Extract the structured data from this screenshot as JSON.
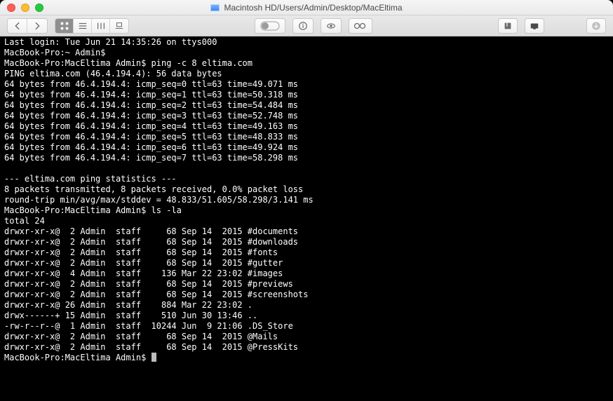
{
  "window": {
    "title": "Macintosh HD/Users/Admin/Desktop/MacEltima"
  },
  "terminal": {
    "last_login": "Last login: Tue Jun 21 14:35:26 on ttys000",
    "prompt_home": "MacBook-Pro:~ Admin$ ",
    "prompt_dir": "MacBook-Pro:MacEltima Admin$ ",
    "cmd_ping": "ping -c 8 eltima.com",
    "ping_header": "PING eltima.com (46.4.194.4): 56 data bytes",
    "ping_lines": [
      "64 bytes from 46.4.194.4: icmp_seq=0 ttl=63 time=49.071 ms",
      "64 bytes from 46.4.194.4: icmp_seq=1 ttl=63 time=50.318 ms",
      "64 bytes from 46.4.194.4: icmp_seq=2 ttl=63 time=54.484 ms",
      "64 bytes from 46.4.194.4: icmp_seq=3 ttl=63 time=52.748 ms",
      "64 bytes from 46.4.194.4: icmp_seq=4 ttl=63 time=49.163 ms",
      "64 bytes from 46.4.194.4: icmp_seq=5 ttl=63 time=48.833 ms",
      "64 bytes from 46.4.194.4: icmp_seq=6 ttl=63 time=49.924 ms",
      "64 bytes from 46.4.194.4: icmp_seq=7 ttl=63 time=58.298 ms"
    ],
    "stats_header": "--- eltima.com ping statistics ---",
    "stats_line1": "8 packets transmitted, 8 packets received, 0.0% packet loss",
    "stats_line2": "round-trip min/avg/max/stddev = 48.833/51.605/58.298/3.141 ms",
    "cmd_ls": "ls -la",
    "ls_total": "total 24",
    "ls_rows": [
      "drwxr-xr-x@  2 Admin  staff     68 Sep 14  2015 #documents",
      "drwxr-xr-x@  2 Admin  staff     68 Sep 14  2015 #downloads",
      "drwxr-xr-x@  2 Admin  staff     68 Sep 14  2015 #fonts",
      "drwxr-xr-x@  2 Admin  staff     68 Sep 14  2015 #gutter",
      "drwxr-xr-x@  4 Admin  staff    136 Mar 22 23:02 #images",
      "drwxr-xr-x@  2 Admin  staff     68 Sep 14  2015 #previews",
      "drwxr-xr-x@  2 Admin  staff     68 Sep 14  2015 #screenshots",
      "drwxr-xr-x@ 26 Admin  staff    884 Mar 22 23:02 .",
      "drwx------+ 15 Admin  staff    510 Jun 30 13:46 ..",
      "-rw-r--r--@  1 Admin  staff  10244 Jun  9 21:06 .DS_Store",
      "drwxr-xr-x@  2 Admin  staff     68 Sep 14  2015 @Mails",
      "drwxr-xr-x@  2 Admin  staff     68 Sep 14  2015 @PressKits"
    ]
  }
}
